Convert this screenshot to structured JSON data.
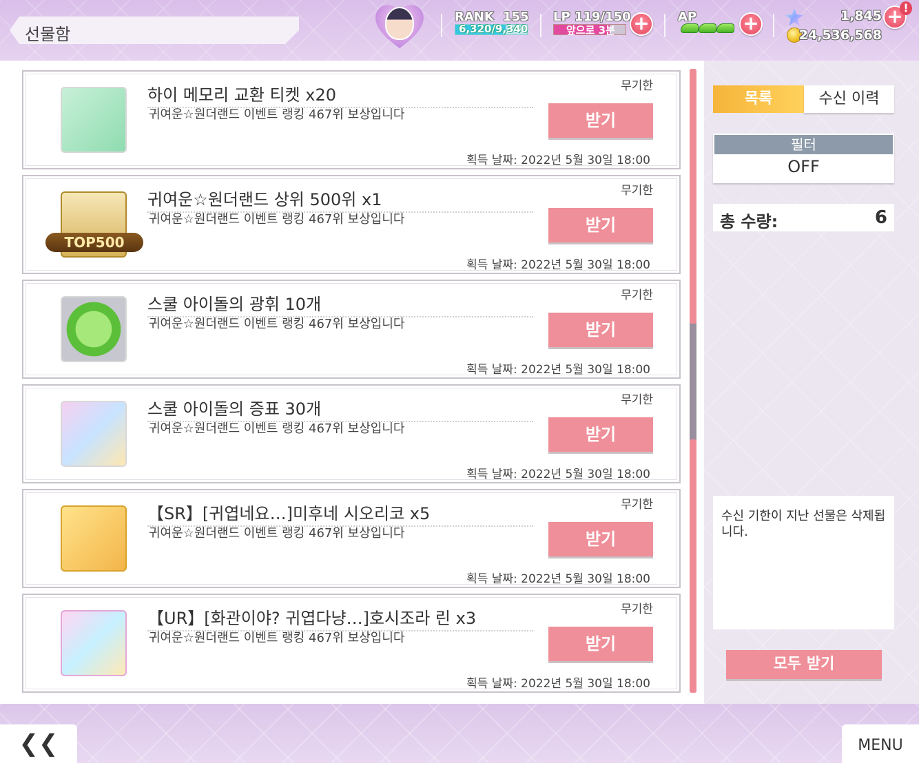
{
  "header": {
    "title": "선물함",
    "rank_label": "RANK",
    "rank_value": "155",
    "rank_exp": "6,320/9,340",
    "lp_label": "LP 119/150",
    "lp_sub": "앞으로 3분",
    "lp_level": 0.79,
    "ap_label": "AP",
    "stars": "1,845",
    "gold": "24,536,568",
    "alert": "!"
  },
  "gifts": [
    {
      "name": "하이 메모리 교환 티켓 x20",
      "desc": "귀여운☆원더랜드 이벤트 랭킹 467위 보상입니다",
      "expiry": "무기한",
      "button": "받기",
      "date": "획득 날짜: 2022년 5월 30일 18:00",
      "icon": "ticket-icon"
    },
    {
      "name": "귀여운☆원더랜드 상위 500위 x1",
      "desc": "귀여운☆원더랜드 이벤트 랭킹 467위 보상입니다",
      "expiry": "무기한",
      "button": "받기",
      "date": "획득 날짜: 2022년 5월 30일 18:00",
      "icon": "top500-badge-icon",
      "badge_text": "TOP500"
    },
    {
      "name": "스쿨 아이돌의 광휘 10개",
      "desc": "귀여운☆원더랜드 이벤트 랭킹 467위 보상입니다",
      "expiry": "무기한",
      "button": "받기",
      "date": "획득 날짜: 2022년 5월 30일 18:00",
      "icon": "green-gem-icon"
    },
    {
      "name": "스쿨 아이돌의 증표 30개",
      "desc": "귀여운☆원더랜드 이벤트 랭킹 467위 보상입니다",
      "expiry": "무기한",
      "button": "받기",
      "date": "획득 날짜: 2022년 5월 30일 18:00",
      "icon": "badge-icon"
    },
    {
      "name": "【SR】[귀엽네요…]미후네 시오리코 x5",
      "desc": "귀여운☆원더랜드 이벤트 랭킹 467위 보상입니다",
      "expiry": "무기한",
      "button": "받기",
      "date": "획득 날짜: 2022년 5월 30일 18:00",
      "icon": "card-sr-icon"
    },
    {
      "name": "【UR】[화관이야? 귀엽다냥…]호시조라 린 x3",
      "desc": "귀여운☆원더랜드 이벤트 랭킹 467위 보상입니다",
      "expiry": "무기한",
      "button": "받기",
      "date": "획득 날짜: 2022년 5월 30일 18:00",
      "icon": "card-ur-icon"
    }
  ],
  "side": {
    "tab_list": "목록",
    "tab_history": "수신 이력",
    "filter_label": "필터",
    "filter_value": "OFF",
    "total_label": "총 수량:",
    "total_value": "6",
    "notice": "수신 기한이 지난 선물은 삭제됩니다.",
    "receive_all": "모두 받기"
  },
  "footer": {
    "back": "❮❮",
    "menu": "MENU"
  },
  "colors": {
    "accent_pink": "#ef8f99",
    "tab_active": "#f6b43b",
    "filter_header": "#8d9aa9"
  }
}
